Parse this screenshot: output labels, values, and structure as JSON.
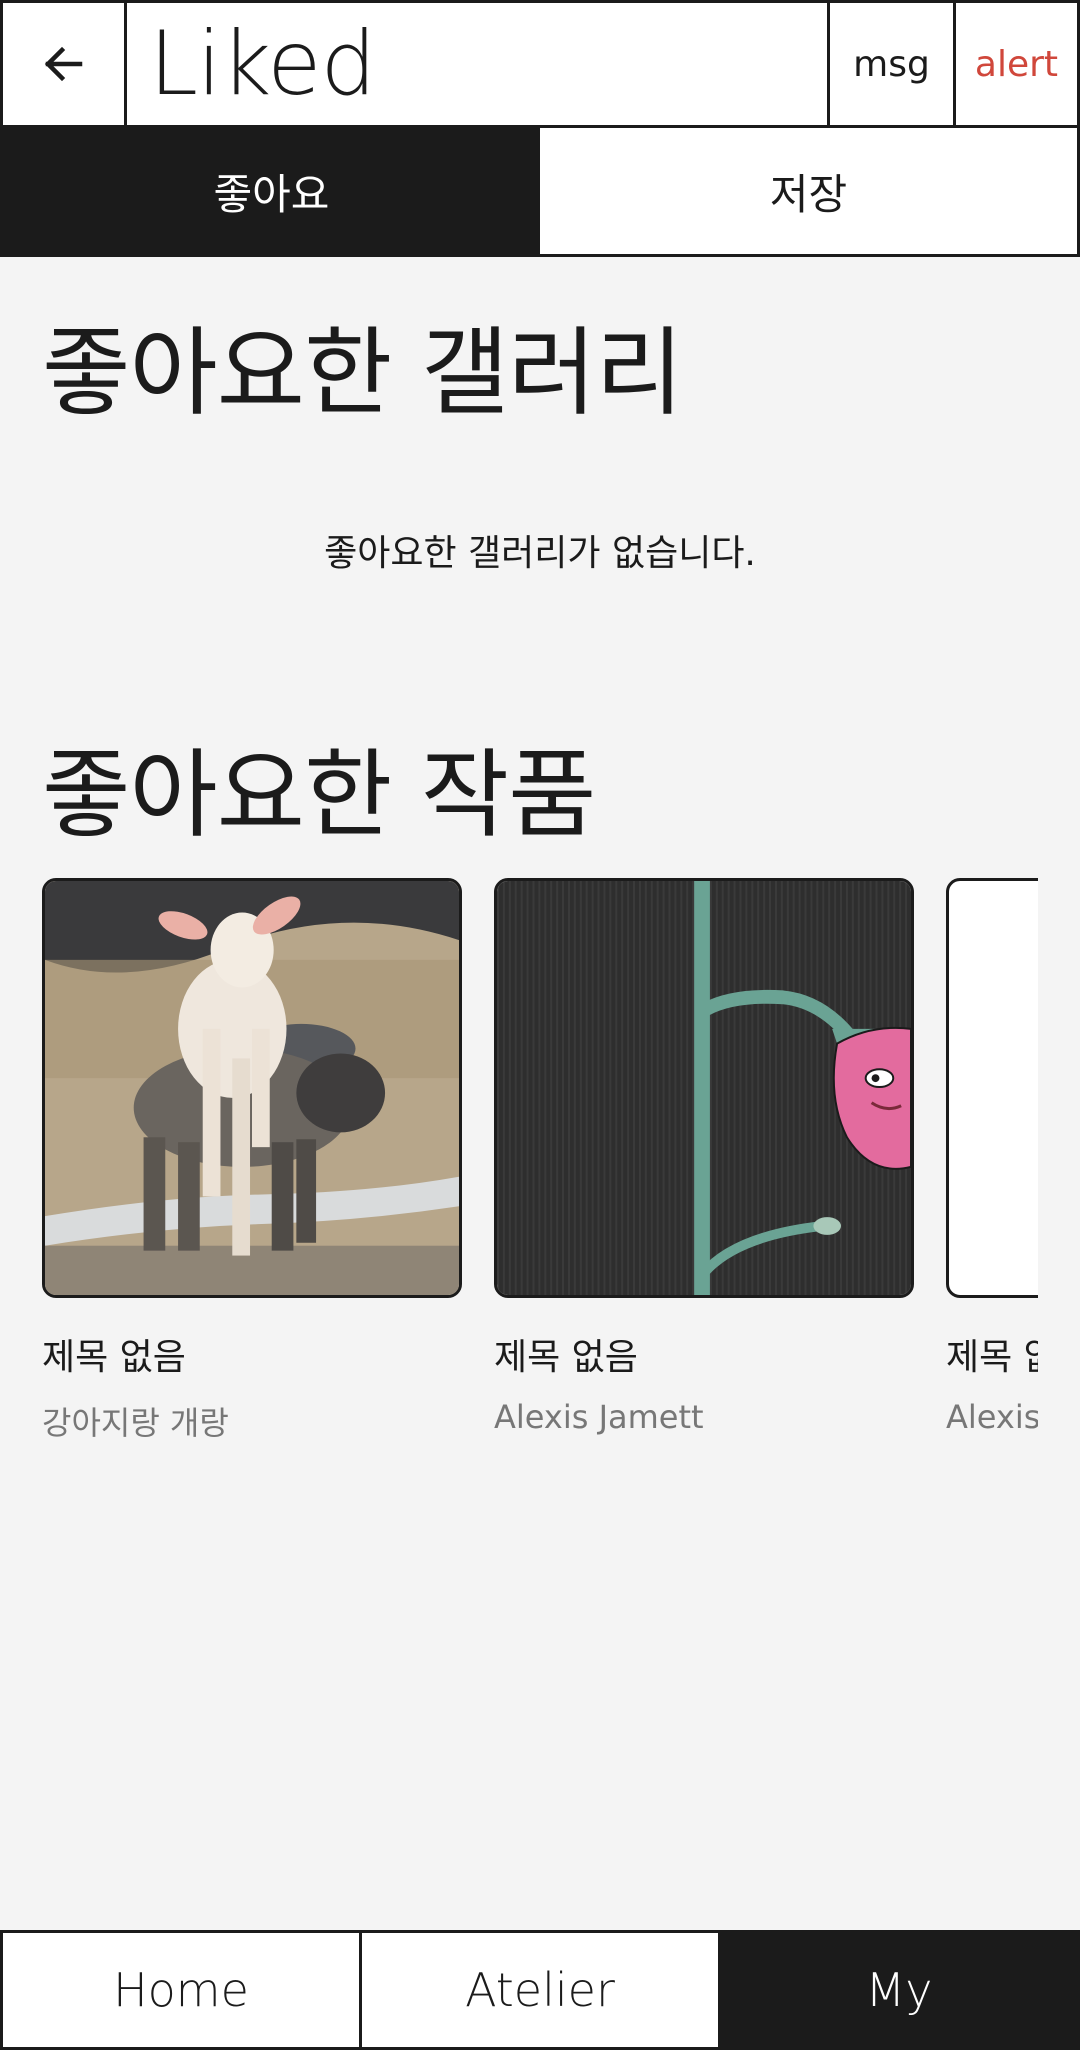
{
  "header": {
    "back_icon": "arrow-left-icon",
    "title": "Liked",
    "msg_label": "msg",
    "alert_label": "alert",
    "alert_color": "#d0473b"
  },
  "tabs": [
    {
      "label": "좋아요",
      "active": true
    },
    {
      "label": "저장",
      "active": false
    }
  ],
  "gallery_section": {
    "title": "좋아요한 갤러리",
    "empty_message": "좋아요한 갤러리가 없습니다."
  },
  "artworks_section": {
    "title": "좋아요한 작품",
    "items": [
      {
        "title": "제목 없음",
        "author": "강아지랑 개랑",
        "image": "goats-photo"
      },
      {
        "title": "제목 없음",
        "author": "Alexis Jamett",
        "image": "flower-drawing"
      },
      {
        "title": "제목 없음",
        "author": "Alexis Jamett",
        "image": "blank"
      }
    ]
  },
  "bottom_nav": {
    "items": [
      {
        "label": "Home",
        "active": false
      },
      {
        "label": "Atelier",
        "active": false
      },
      {
        "label": "My",
        "active": true
      }
    ]
  },
  "colors": {
    "dark": "#1b1b1b",
    "background": "#f4f4f4",
    "muted_text": "#777777"
  }
}
